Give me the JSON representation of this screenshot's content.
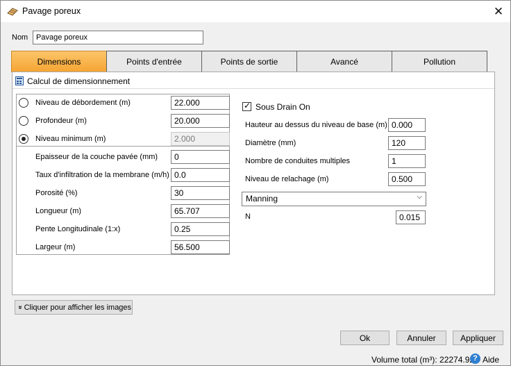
{
  "window": {
    "title": "Pavage poreux",
    "close_glyph": "✕"
  },
  "name_field": {
    "label": "Nom",
    "value": "Pavage poreux"
  },
  "tabs": [
    {
      "label": "Dimensions",
      "active": true
    },
    {
      "label": "Points d'entrée",
      "active": false
    },
    {
      "label": "Points de sortie",
      "active": false
    },
    {
      "label": "Avancé",
      "active": false
    },
    {
      "label": "Pollution",
      "active": false
    }
  ],
  "section": {
    "title": "Calcul de dimensionnement",
    "icon": "calculator-icon"
  },
  "radio_fields": [
    {
      "label": "Niveau de débordement (m)",
      "value": "22.000",
      "checked": false,
      "disabled": false
    },
    {
      "label": "Profondeur (m)",
      "value": "20.000",
      "checked": false,
      "disabled": false
    },
    {
      "label": "Niveau minimum (m)",
      "value": "2.000",
      "checked": true,
      "disabled": true
    }
  ],
  "left_fields": [
    {
      "label": "Epaisseur de la couche pavée (mm)",
      "value": "0"
    },
    {
      "label": "Taux d'infiltration de la membrane (m/h)",
      "value": "0.0"
    },
    {
      "label": "Porosité (%)",
      "value": "30"
    },
    {
      "label": "Longueur (m)",
      "value": "65.707"
    },
    {
      "label": "Pente Longitudinale (1:x)",
      "value": "0.25"
    },
    {
      "label": "Largeur (m)",
      "value": "56.500"
    }
  ],
  "sous_drain": {
    "label": "Sous Drain On",
    "checked": true,
    "check_glyph": "✓"
  },
  "right_fields": [
    {
      "label": "Hauteur au dessus du niveau de base (m)",
      "value": "0.000"
    },
    {
      "label": "Diamètre (mm)",
      "value": "120"
    },
    {
      "label": "Nombre de conduites multiples",
      "value": "1"
    },
    {
      "label": "Niveau de relachage (m)",
      "value": "0.500"
    }
  ],
  "formula_select": {
    "value": "Manning",
    "chevron": "⌵"
  },
  "n_field": {
    "label": "N",
    "value": "0.015"
  },
  "images_button": {
    "label": "Cliquer pour afficher les images",
    "icon_glyph": "»"
  },
  "buttons": {
    "ok": "Ok",
    "cancel": "Annuler",
    "apply": "Appliquer"
  },
  "status": {
    "volume": "Volume total (m³): 22274.924",
    "help": "Aide",
    "help_glyph": "?"
  },
  "colors": {
    "active_tab": "#f6a534",
    "help_icon": "#2f7fd0"
  }
}
